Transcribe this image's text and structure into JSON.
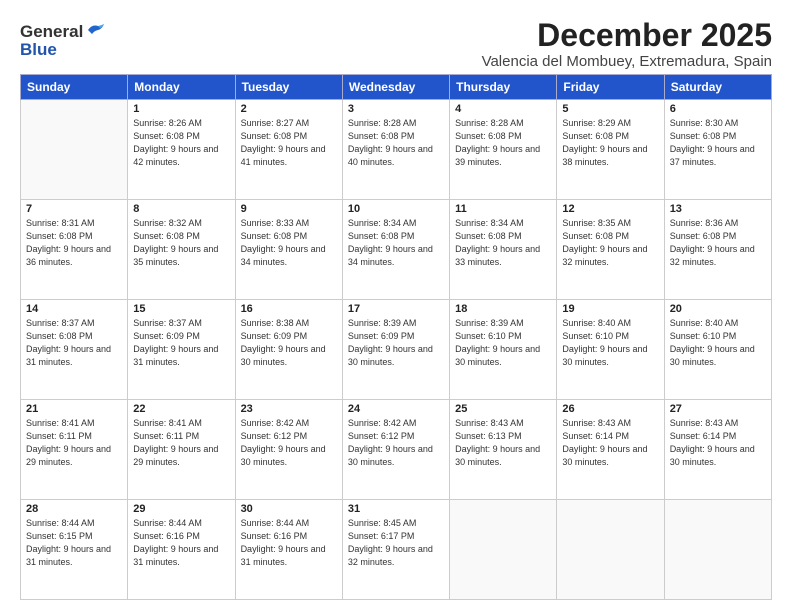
{
  "header": {
    "logo_general": "General",
    "logo_blue": "Blue",
    "month_title": "December 2025",
    "location": "Valencia del Mombuey, Extremadura, Spain"
  },
  "weekdays": [
    "Sunday",
    "Monday",
    "Tuesday",
    "Wednesday",
    "Thursday",
    "Friday",
    "Saturday"
  ],
  "weeks": [
    [
      {
        "day": null,
        "info": null
      },
      {
        "day": "1",
        "sunrise": "Sunrise: 8:26 AM",
        "sunset": "Sunset: 6:08 PM",
        "daylight": "Daylight: 9 hours and 42 minutes."
      },
      {
        "day": "2",
        "sunrise": "Sunrise: 8:27 AM",
        "sunset": "Sunset: 6:08 PM",
        "daylight": "Daylight: 9 hours and 41 minutes."
      },
      {
        "day": "3",
        "sunrise": "Sunrise: 8:28 AM",
        "sunset": "Sunset: 6:08 PM",
        "daylight": "Daylight: 9 hours and 40 minutes."
      },
      {
        "day": "4",
        "sunrise": "Sunrise: 8:28 AM",
        "sunset": "Sunset: 6:08 PM",
        "daylight": "Daylight: 9 hours and 39 minutes."
      },
      {
        "day": "5",
        "sunrise": "Sunrise: 8:29 AM",
        "sunset": "Sunset: 6:08 PM",
        "daylight": "Daylight: 9 hours and 38 minutes."
      },
      {
        "day": "6",
        "sunrise": "Sunrise: 8:30 AM",
        "sunset": "Sunset: 6:08 PM",
        "daylight": "Daylight: 9 hours and 37 minutes."
      }
    ],
    [
      {
        "day": "7",
        "sunrise": "Sunrise: 8:31 AM",
        "sunset": "Sunset: 6:08 PM",
        "daylight": "Daylight: 9 hours and 36 minutes."
      },
      {
        "day": "8",
        "sunrise": "Sunrise: 8:32 AM",
        "sunset": "Sunset: 6:08 PM",
        "daylight": "Daylight: 9 hours and 35 minutes."
      },
      {
        "day": "9",
        "sunrise": "Sunrise: 8:33 AM",
        "sunset": "Sunset: 6:08 PM",
        "daylight": "Daylight: 9 hours and 34 minutes."
      },
      {
        "day": "10",
        "sunrise": "Sunrise: 8:34 AM",
        "sunset": "Sunset: 6:08 PM",
        "daylight": "Daylight: 9 hours and 34 minutes."
      },
      {
        "day": "11",
        "sunrise": "Sunrise: 8:34 AM",
        "sunset": "Sunset: 6:08 PM",
        "daylight": "Daylight: 9 hours and 33 minutes."
      },
      {
        "day": "12",
        "sunrise": "Sunrise: 8:35 AM",
        "sunset": "Sunset: 6:08 PM",
        "daylight": "Daylight: 9 hours and 32 minutes."
      },
      {
        "day": "13",
        "sunrise": "Sunrise: 8:36 AM",
        "sunset": "Sunset: 6:08 PM",
        "daylight": "Daylight: 9 hours and 32 minutes."
      }
    ],
    [
      {
        "day": "14",
        "sunrise": "Sunrise: 8:37 AM",
        "sunset": "Sunset: 6:08 PM",
        "daylight": "Daylight: 9 hours and 31 minutes."
      },
      {
        "day": "15",
        "sunrise": "Sunrise: 8:37 AM",
        "sunset": "Sunset: 6:09 PM",
        "daylight": "Daylight: 9 hours and 31 minutes."
      },
      {
        "day": "16",
        "sunrise": "Sunrise: 8:38 AM",
        "sunset": "Sunset: 6:09 PM",
        "daylight": "Daylight: 9 hours and 30 minutes."
      },
      {
        "day": "17",
        "sunrise": "Sunrise: 8:39 AM",
        "sunset": "Sunset: 6:09 PM",
        "daylight": "Daylight: 9 hours and 30 minutes."
      },
      {
        "day": "18",
        "sunrise": "Sunrise: 8:39 AM",
        "sunset": "Sunset: 6:10 PM",
        "daylight": "Daylight: 9 hours and 30 minutes."
      },
      {
        "day": "19",
        "sunrise": "Sunrise: 8:40 AM",
        "sunset": "Sunset: 6:10 PM",
        "daylight": "Daylight: 9 hours and 30 minutes."
      },
      {
        "day": "20",
        "sunrise": "Sunrise: 8:40 AM",
        "sunset": "Sunset: 6:10 PM",
        "daylight": "Daylight: 9 hours and 30 minutes."
      }
    ],
    [
      {
        "day": "21",
        "sunrise": "Sunrise: 8:41 AM",
        "sunset": "Sunset: 6:11 PM",
        "daylight": "Daylight: 9 hours and 29 minutes."
      },
      {
        "day": "22",
        "sunrise": "Sunrise: 8:41 AM",
        "sunset": "Sunset: 6:11 PM",
        "daylight": "Daylight: 9 hours and 29 minutes."
      },
      {
        "day": "23",
        "sunrise": "Sunrise: 8:42 AM",
        "sunset": "Sunset: 6:12 PM",
        "daylight": "Daylight: 9 hours and 30 minutes."
      },
      {
        "day": "24",
        "sunrise": "Sunrise: 8:42 AM",
        "sunset": "Sunset: 6:12 PM",
        "daylight": "Daylight: 9 hours and 30 minutes."
      },
      {
        "day": "25",
        "sunrise": "Sunrise: 8:43 AM",
        "sunset": "Sunset: 6:13 PM",
        "daylight": "Daylight: 9 hours and 30 minutes."
      },
      {
        "day": "26",
        "sunrise": "Sunrise: 8:43 AM",
        "sunset": "Sunset: 6:14 PM",
        "daylight": "Daylight: 9 hours and 30 minutes."
      },
      {
        "day": "27",
        "sunrise": "Sunrise: 8:43 AM",
        "sunset": "Sunset: 6:14 PM",
        "daylight": "Daylight: 9 hours and 30 minutes."
      }
    ],
    [
      {
        "day": "28",
        "sunrise": "Sunrise: 8:44 AM",
        "sunset": "Sunset: 6:15 PM",
        "daylight": "Daylight: 9 hours and 31 minutes."
      },
      {
        "day": "29",
        "sunrise": "Sunrise: 8:44 AM",
        "sunset": "Sunset: 6:16 PM",
        "daylight": "Daylight: 9 hours and 31 minutes."
      },
      {
        "day": "30",
        "sunrise": "Sunrise: 8:44 AM",
        "sunset": "Sunset: 6:16 PM",
        "daylight": "Daylight: 9 hours and 31 minutes."
      },
      {
        "day": "31",
        "sunrise": "Sunrise: 8:45 AM",
        "sunset": "Sunset: 6:17 PM",
        "daylight": "Daylight: 9 hours and 32 minutes."
      },
      {
        "day": null,
        "info": null
      },
      {
        "day": null,
        "info": null
      },
      {
        "day": null,
        "info": null
      }
    ]
  ]
}
